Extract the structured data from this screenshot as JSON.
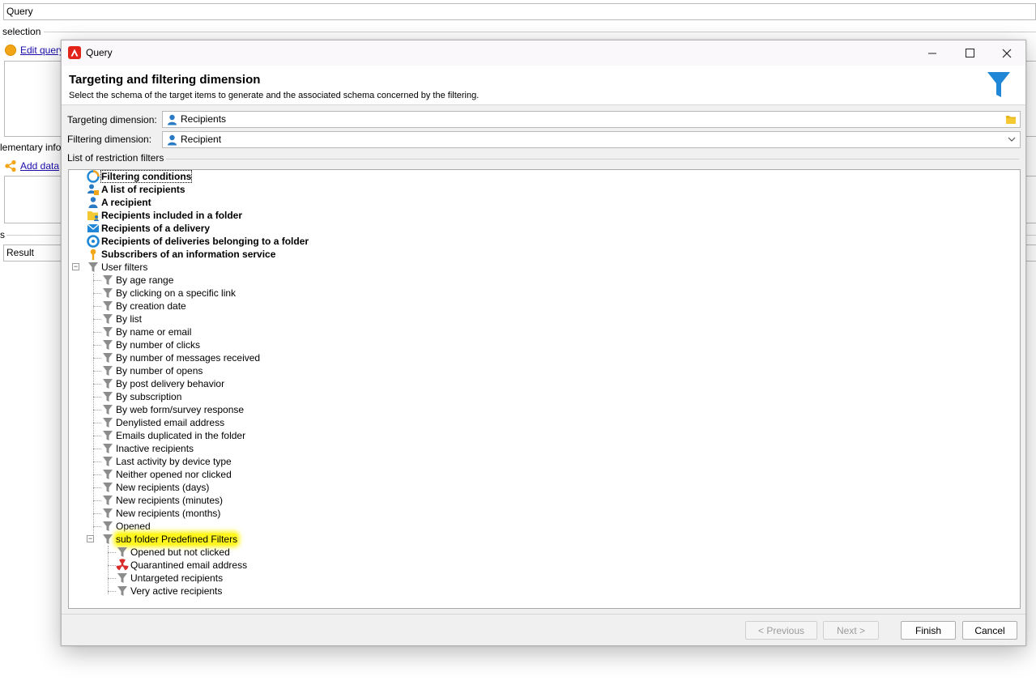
{
  "background": {
    "query_field": "Query",
    "selection_label": "selection",
    "edit_query_link": "Edit query",
    "elementary_label": "lementary info",
    "add_data_link": "Add data",
    "section_s_label": "s",
    "result_field": "Result"
  },
  "dialog": {
    "title": "Query",
    "header_title": "Targeting and filtering dimension",
    "header_subtitle": "Select the schema of the target items to  generate and the associated schema concerned by the filtering.",
    "targeting_label": "Targeting dimension:",
    "targeting_value": "Recipients",
    "filtering_label": "Filtering dimension:",
    "filtering_value": "Recipient",
    "restriction_label": "List of restriction filters",
    "tree": {
      "top_items": [
        {
          "label": "Filtering conditions",
          "icon": "filtering-conditions-icon"
        },
        {
          "label": "A list of recipients",
          "icon": "recipients-list-icon"
        },
        {
          "label": "A recipient",
          "icon": "recipient-icon"
        },
        {
          "label": "Recipients included in a folder",
          "icon": "folder-recipients-icon"
        },
        {
          "label": "Recipients of a delivery",
          "icon": "delivery-icon"
        },
        {
          "label": "Recipients of deliveries belonging to a folder",
          "icon": "delivery-folder-icon"
        },
        {
          "label": "Subscribers of an information service",
          "icon": "service-icon"
        }
      ],
      "user_filters_label": "User filters",
      "user_filters": [
        "By age range",
        "By clicking on a specific link",
        "By creation date",
        "By list",
        "By name or email",
        "By number of clicks",
        "By number of messages received",
        "By number of opens",
        "By post delivery behavior",
        "By subscription",
        "By web form/survey response",
        "Denylisted email address",
        "Emails duplicated in the folder",
        "Inactive recipients",
        "Last activity by device type",
        "Neither opened nor clicked",
        "New recipients (days)",
        "New recipients (minutes)",
        "New recipients (months)",
        "Opened"
      ],
      "subfolder_label": "sub folder Predefined Filters",
      "subfolder_items": [
        {
          "label": "Opened but not clicked",
          "icon": "filter-icon"
        },
        {
          "label": "Quarantined email address",
          "icon": "quarantine-icon"
        },
        {
          "label": "Untargeted recipients",
          "icon": "filter-icon"
        },
        {
          "label": "Very active recipients",
          "icon": "filter-icon"
        }
      ]
    },
    "buttons": {
      "previous": "< Previous",
      "next": "Next >",
      "finish": "Finish",
      "cancel": "Cancel"
    },
    "colors": {
      "highlight": "#fff61e",
      "accent_blue": "#1f87d6",
      "app_red": "#e2231a"
    }
  }
}
